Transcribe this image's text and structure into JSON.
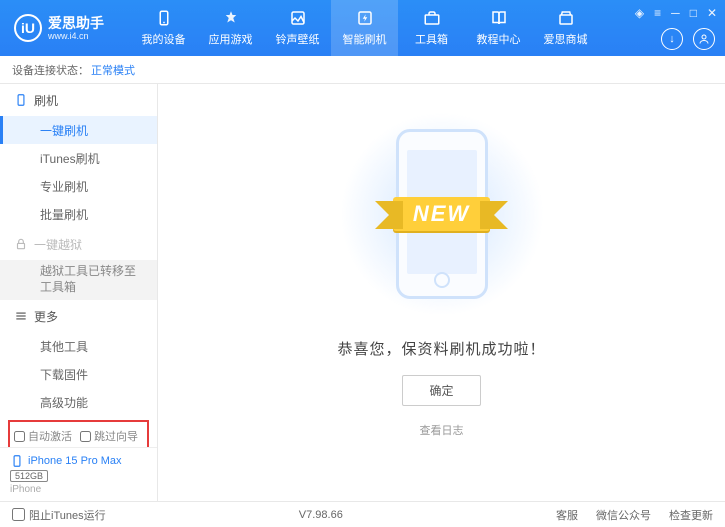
{
  "app": {
    "title": "爱思助手",
    "url": "www.i4.cn",
    "logo_letters": "iU"
  },
  "nav": {
    "items": [
      {
        "label": "我的设备"
      },
      {
        "label": "应用游戏"
      },
      {
        "label": "铃声壁纸"
      },
      {
        "label": "智能刷机"
      },
      {
        "label": "工具箱"
      },
      {
        "label": "教程中心"
      },
      {
        "label": "爱思商城"
      }
    ],
    "active_index": 3
  },
  "status": {
    "label": "设备连接状态：",
    "value": "正常模式"
  },
  "sidebar": {
    "sections": [
      {
        "title": "刷机",
        "items": [
          "一键刷机",
          "iTunes刷机",
          "专业刷机",
          "批量刷机"
        ]
      },
      {
        "title": "一键越狱",
        "locked": true,
        "items": [
          "越狱工具已转移至工具箱"
        ]
      },
      {
        "title": "更多",
        "items": [
          "其他工具",
          "下载固件",
          "高级功能"
        ]
      }
    ],
    "active_item": "一键刷机",
    "checks": {
      "auto_activate": "自动激活",
      "skip_guide": "跳过向导"
    },
    "device": {
      "name": "iPhone 15 Pro Max",
      "storage": "512GB",
      "type": "iPhone"
    }
  },
  "main": {
    "ribbon": "NEW",
    "success": "恭喜您，保资料刷机成功啦！",
    "ok": "确定",
    "view_log": "查看日志"
  },
  "footer": {
    "block_itunes": "阻止iTunes运行",
    "version": "V7.98.66",
    "links": [
      "客服",
      "微信公众号",
      "检查更新"
    ]
  }
}
